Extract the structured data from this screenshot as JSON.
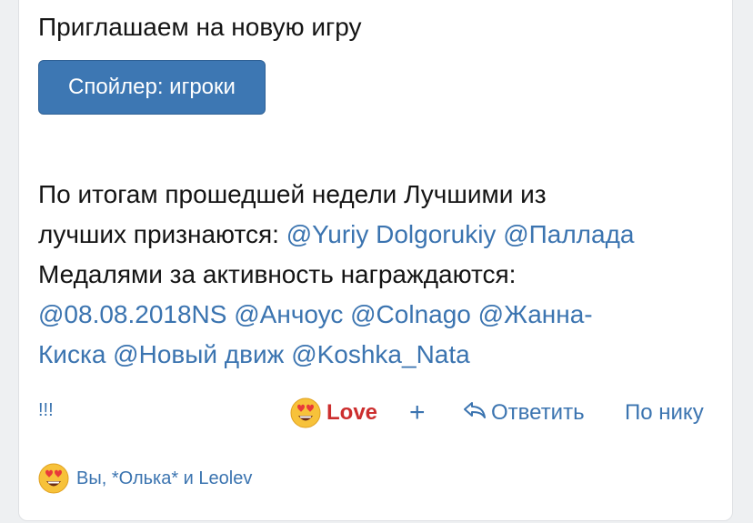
{
  "post": {
    "intro": "Приглашаем на новую игру",
    "spoiler_label": "Спойлер: игроки",
    "line1": "По итогам прошедшей недели Лучшими из",
    "line2_text": "лучших признаются:",
    "best": [
      "@Yuriy Dolgorukiy",
      "@Паллада"
    ],
    "line3": "Медалями за активность награждаются:",
    "medals_line4": [
      "@08.08.2018NS",
      "@Анчоус",
      "@Colnago",
      "@Жанна-"
    ],
    "medals_line5": [
      "Киска",
      "@Новый движ",
      "@Koshka_Nata"
    ],
    "trailing": "!!!"
  },
  "actions": {
    "love_label": "Love",
    "love_icon": "heart-eyes-emoji-icon",
    "plus_label": "+",
    "reply_label": "Ответить",
    "reply_icon": "reply-arrow-icon",
    "by_nick_label": "По нику"
  },
  "reactions": {
    "summary": "Вы, *Олька* и Leolev",
    "icon": "heart-eyes-emoji-icon"
  },
  "colors": {
    "link": "#3b74b0",
    "button_bg": "#3d77b3",
    "love": "#cc2e2e",
    "text": "#141414"
  }
}
